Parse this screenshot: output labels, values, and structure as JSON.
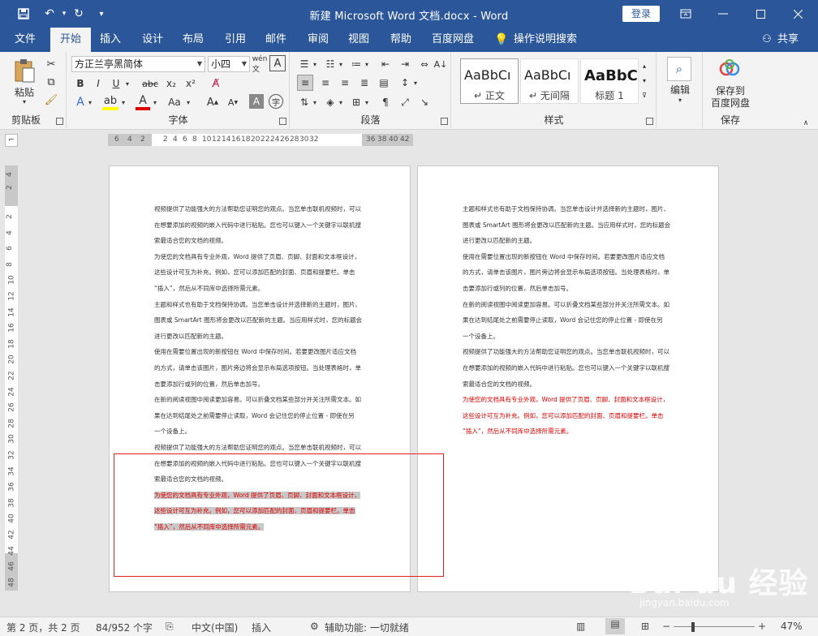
{
  "titlebar": {
    "title": "新建 Microsoft Word 文档.docx - Word",
    "login": "登录",
    "save_icon": "save-icon",
    "undo_icon": "undo-icon",
    "redo_icon": "redo-icon"
  },
  "tabs": [
    "文件",
    "开始",
    "插入",
    "设计",
    "布局",
    "引用",
    "邮件",
    "审阅",
    "视图",
    "帮助",
    "百度网盘"
  ],
  "active_tab": "开始",
  "search_hint": "操作说明搜索",
  "share": "共享",
  "ribbon": {
    "clipboard": {
      "paste": "粘贴",
      "label": "剪贴板"
    },
    "font": {
      "name": "方正兰亭黑简体",
      "size": "小四",
      "label": "字体"
    },
    "paragraph": {
      "label": "段落"
    },
    "styles": {
      "label": "样式",
      "items": [
        {
          "sample": "AaBbCı",
          "name": "正文"
        },
        {
          "sample": "AaBbCı",
          "name": "无间隔"
        },
        {
          "sample": "AaBbC",
          "name": "标题 1"
        }
      ]
    },
    "edit": {
      "label": "编辑"
    },
    "save": {
      "line1": "保存到",
      "line2": "百度网盘",
      "label": "保存"
    }
  },
  "hruler": [
    "6",
    "4",
    "2",
    "2",
    "4",
    "6",
    "8",
    "10",
    "12",
    "14",
    "16",
    "18",
    "20",
    "22",
    "24",
    "26",
    "28",
    "30",
    "32",
    "36",
    "38",
    "40",
    "42"
  ],
  "vruler": [
    "4",
    "2",
    "2",
    "4",
    "6",
    "8",
    "10",
    "12",
    "14",
    "16",
    "18",
    "20",
    "22",
    "24",
    "26",
    "28",
    "30",
    "32",
    "34",
    "36",
    "38",
    "40",
    "42",
    "44",
    "46",
    "48"
  ],
  "page1": {
    "lines": [
      "视频提供了功能强大的方法帮助您证明您的观点。当您单击联机视频时，可以",
      "在想要添加的视频的嵌入代码中进行粘贴。您也可以键入一个关键字以联机搜",
      "索最适合您的文档的视频。",
      "为使您的文档具有专业外观，Word 提供了页眉、页脚、封面和文本框设计，",
      "这些设计可互为补充。例如，您可以添加匹配的封面、页眉和提要栏。单击",
      "“插入”，然后从不同库中选择所需元素。",
      "主题和样式也有助于文档保持协调。当您单击设计并选择新的主题时，图片、",
      "图表或 SmartArt 图形将会更改以匹配新的主题。当应用样式时，您的标题会",
      "进行更改以匹配新的主题。",
      "使用在需要位置出现的新按钮在 Word 中保存时间。若要更改图片适应文档",
      "的方式，请单击该图片，图片旁边将会显示布局选项按钮。当处理表格时，单",
      "击要添加行或列的位置，然后单击加号。",
      "在新的阅读视图中阅读更加容易。可以折叠文档某些部分并关注所需文本。如",
      "果在达到结尾处之前需要停止读取，Word 会记住您的停止位置 - 即使在另",
      "一个设备上。",
      "视频提供了功能强大的方法帮助您证明您的观点。当您单击联机视频时，可以",
      "在想要添加的视频的嵌入代码中进行粘贴。您也可以键入一个关键字以联机搜",
      "索最适合您的文档的视频。"
    ],
    "red_lines": [
      "为使您的文档具有专业外观，Word 提供了页眉、页脚、封面和文本框设计，",
      "这些设计可互为补充。例如，您可以添加匹配的封面、页眉和提要栏。单击",
      "“插入”，然后从不同库中选择所需元素。"
    ]
  },
  "page2": {
    "lines": [
      "主题和样式也有助于文档保持协调。当您单击设计并选择新的主题时，图片、",
      "图表或 SmartArt 图形将会更改以匹配新的主题。当应用样式时，您的标题会",
      "进行更改以匹配新的主题。",
      "使用在需要位置出现的新按钮在 Word 中保存时间。若要更改图片适应文档",
      "的方式，请单击该图片，图片旁边将会显示布局选项按钮。当处理表格时，单",
      "击要添加行或列的位置，然后单击加号。",
      "在新的阅读视图中阅读更加容易。可以折叠文档某些部分并关注所需文本。如",
      "果在达到结尾处之前需要停止读取，Word 会记住您的停止位置 - 即使在另",
      "一个设备上。",
      "视频提供了功能强大的方法帮助您证明您的观点。当您单击联机视频时，可以",
      "在想要添加的视频的嵌入代码中进行粘贴。您也可以键入一个关键字以联机搜",
      "索最适合您的文档的视频。"
    ],
    "red_lines": [
      "为使您的文档具有专业外观，Word 提供了页眉、页脚、封面和文本框设计，",
      "这些设计可互为补充。例如，您可以添加匹配的封面、页眉和提要栏。单击",
      "“插入”，然后从不同库中选择所需元素。"
    ]
  },
  "status": {
    "page": "第 2 页，共 2 页",
    "words": "84/952 个字",
    "lang": "中文(中国)",
    "mode": "插入",
    "accessibility": "辅助功能: 一切就绪",
    "zoom": "47%",
    "zoom_level": 0.47
  },
  "watermark": {
    "logo": "Bai du 经验",
    "url": "jingyan.baidu.com"
  },
  "colors": {
    "brand": "#2b579a",
    "red_text": "#e00000",
    "highlight": "#c8c8c8"
  }
}
